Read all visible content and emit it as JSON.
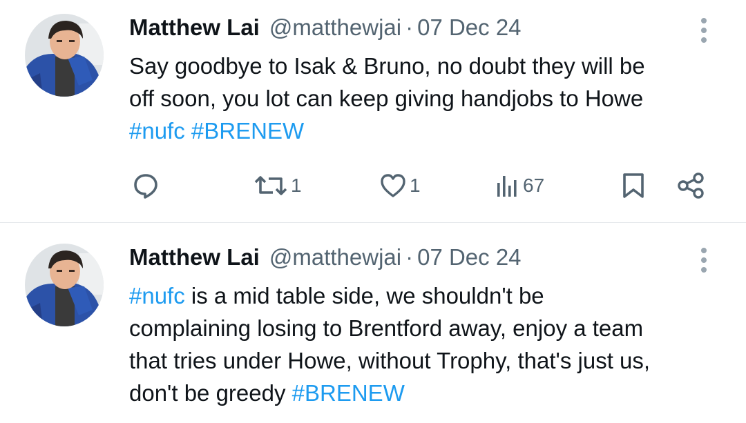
{
  "tweets": [
    {
      "author": {
        "name": "Matthew Lai",
        "handle": "@matthewjai"
      },
      "separator": "·",
      "date": "07 Dec 24",
      "lines": [
        [
          {
            "text": "Say goodbye to Isak & Bruno, no doubt they will be",
            "type": "text"
          }
        ],
        [
          {
            "text": "off soon, you lot can keep giving handjobs to Howe",
            "type": "text"
          }
        ],
        [
          {
            "text": "#nufc",
            "type": "tag"
          },
          {
            "text": " ",
            "type": "text"
          },
          {
            "text": "#BRENEW",
            "type": "tag"
          }
        ]
      ],
      "actions": {
        "reply": {
          "icon": "reply-icon",
          "count": ""
        },
        "repost": {
          "icon": "repost-icon",
          "count": "1"
        },
        "like": {
          "icon": "heart-icon",
          "count": "1"
        },
        "views": {
          "icon": "views-icon",
          "count": "67"
        },
        "bookmark": {
          "icon": "bookmark-icon"
        },
        "share": {
          "icon": "share-icon"
        }
      }
    },
    {
      "author": {
        "name": "Matthew Lai",
        "handle": "@matthewjai"
      },
      "separator": "·",
      "date": "07 Dec 24",
      "lines": [
        [
          {
            "text": "#nufc",
            "type": "tag"
          },
          {
            "text": " is a mid table side, we shouldn't be",
            "type": "text"
          }
        ],
        [
          {
            "text": "complaining losing to Brentford away, enjoy a team",
            "type": "text"
          }
        ],
        [
          {
            "text": "that tries under Howe, without Trophy, that's just us,",
            "type": "text"
          }
        ],
        [
          {
            "text": "don't be greedy ",
            "type": "text"
          },
          {
            "text": "#BRENEW",
            "type": "tag"
          }
        ]
      ]
    }
  ],
  "colors": {
    "text": "#0f1419",
    "secondary": "#536471",
    "link": "#1d9bf0",
    "divider": "#e6e9ec"
  }
}
